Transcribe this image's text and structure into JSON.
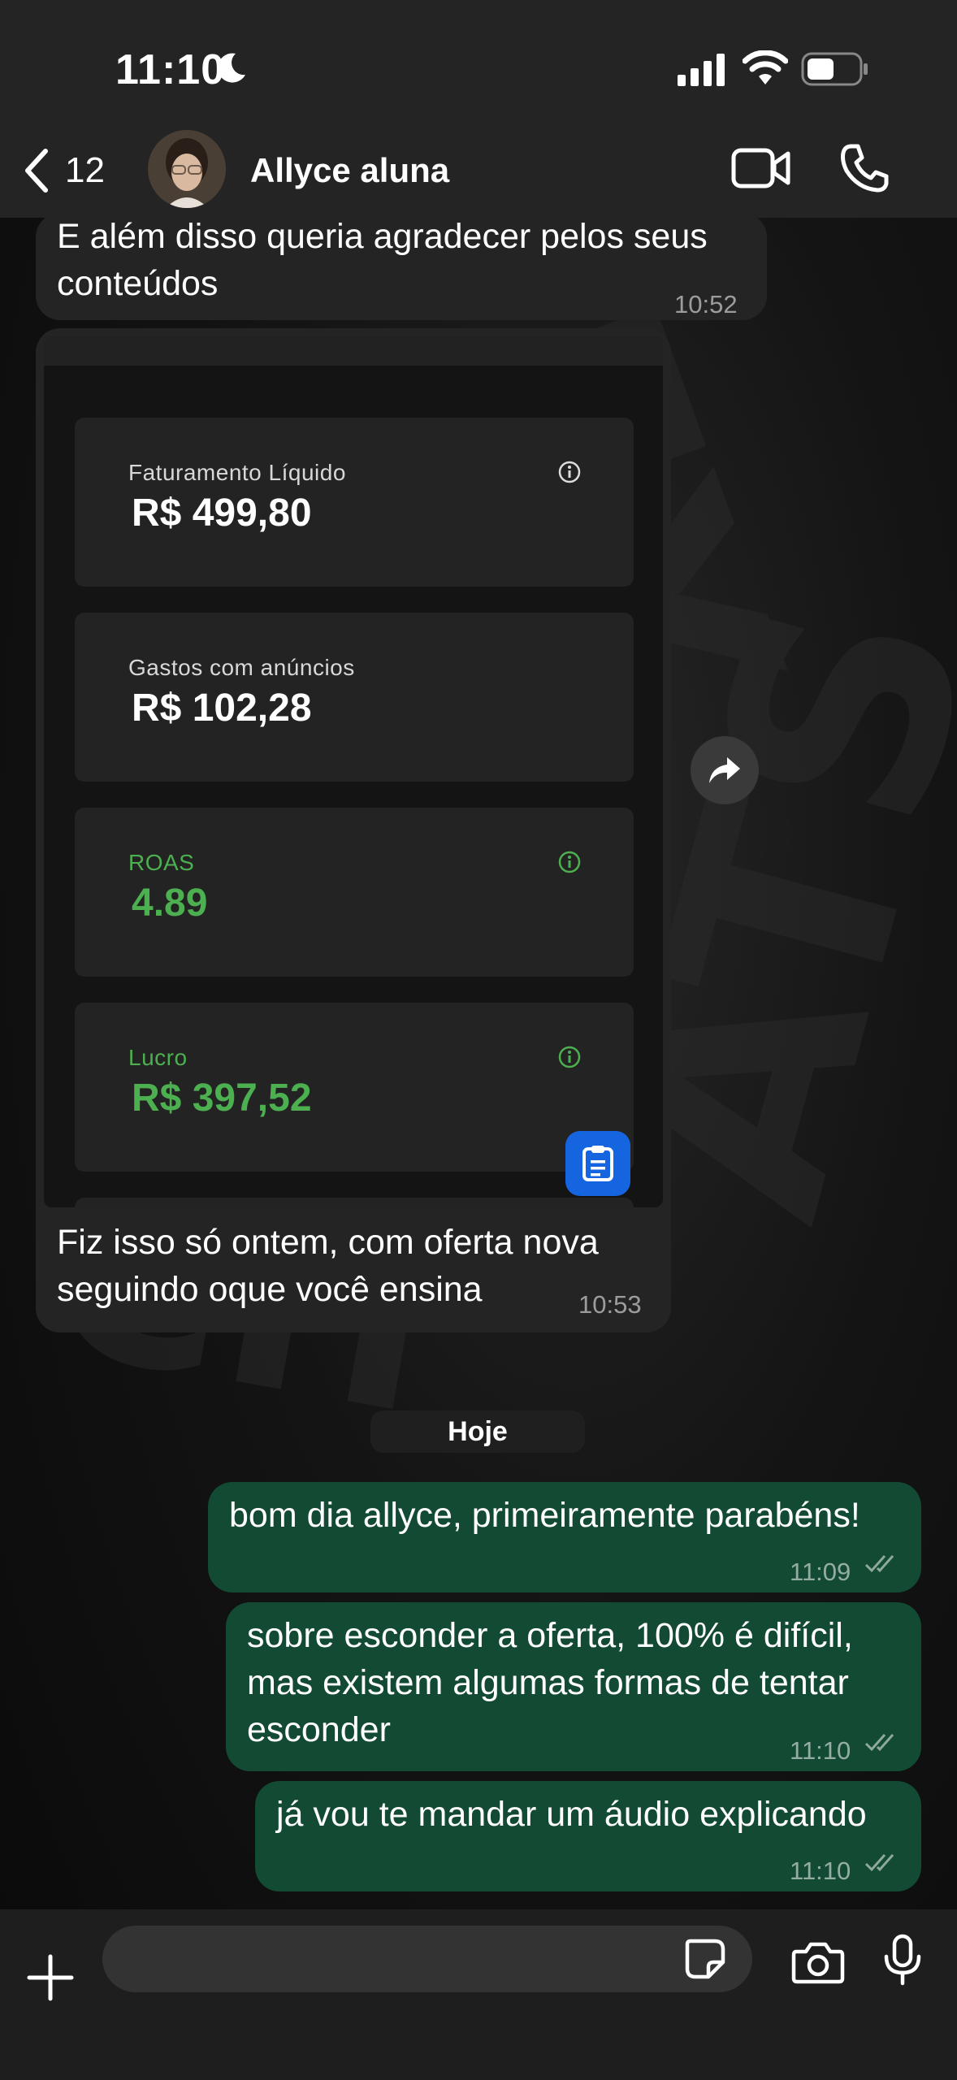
{
  "status_bar": {
    "time": "11:10"
  },
  "header": {
    "back_count": "12",
    "contact_name": "Allyce aluna",
    "icons": [
      "chevron-left-icon",
      "video-camera-icon",
      "phone-icon"
    ]
  },
  "messages": [
    {
      "direction": "incoming",
      "lines": [
        "E além disso queria agradecer pelos seus",
        "conteúdos"
      ],
      "time": "10:52"
    },
    {
      "direction": "incoming",
      "type": "image-with-caption",
      "image": {
        "cards": [
          {
            "label": "Faturamento Líquido",
            "value": "R$ 499,80",
            "info_icon": true,
            "accent": false
          },
          {
            "label": "Gastos com anúncios",
            "value": "R$ 102,28",
            "info_icon": false,
            "accent": false
          },
          {
            "label": "ROAS",
            "value": "4.89",
            "info_icon": true,
            "accent": true
          },
          {
            "label": "Lucro",
            "value": "R$ 397,52",
            "info_icon": true,
            "accent": true
          }
        ]
      },
      "lines": [
        "Fiz isso só ontem, com oferta nova",
        "seguindo oque você ensina"
      ],
      "time": "10:53"
    },
    {
      "direction": "outgoing",
      "lines": [
        "bom dia allyce, primeiramente parabéns!"
      ],
      "time": "11:09",
      "read": true
    },
    {
      "direction": "outgoing",
      "lines": [
        "sobre esconder a oferta, 100% é difícil,",
        "mas existem algumas formas de tentar",
        "esconder"
      ],
      "time": "11:10",
      "read": true
    },
    {
      "direction": "outgoing",
      "lines": [
        "já vou te mandar um áudio explicando"
      ],
      "time": "11:10",
      "read": true
    }
  ],
  "date_divider": "Hoje",
  "colors": {
    "incoming_bubble": "#242424",
    "outgoing_bubble": "#124a34",
    "accent_green": "#4caf50",
    "clipboard_button": "#1565e0"
  },
  "composer": {
    "placeholder": "",
    "icons": [
      "plus-icon",
      "sticker-icon",
      "camera-icon",
      "microphone-icon"
    ]
  }
}
